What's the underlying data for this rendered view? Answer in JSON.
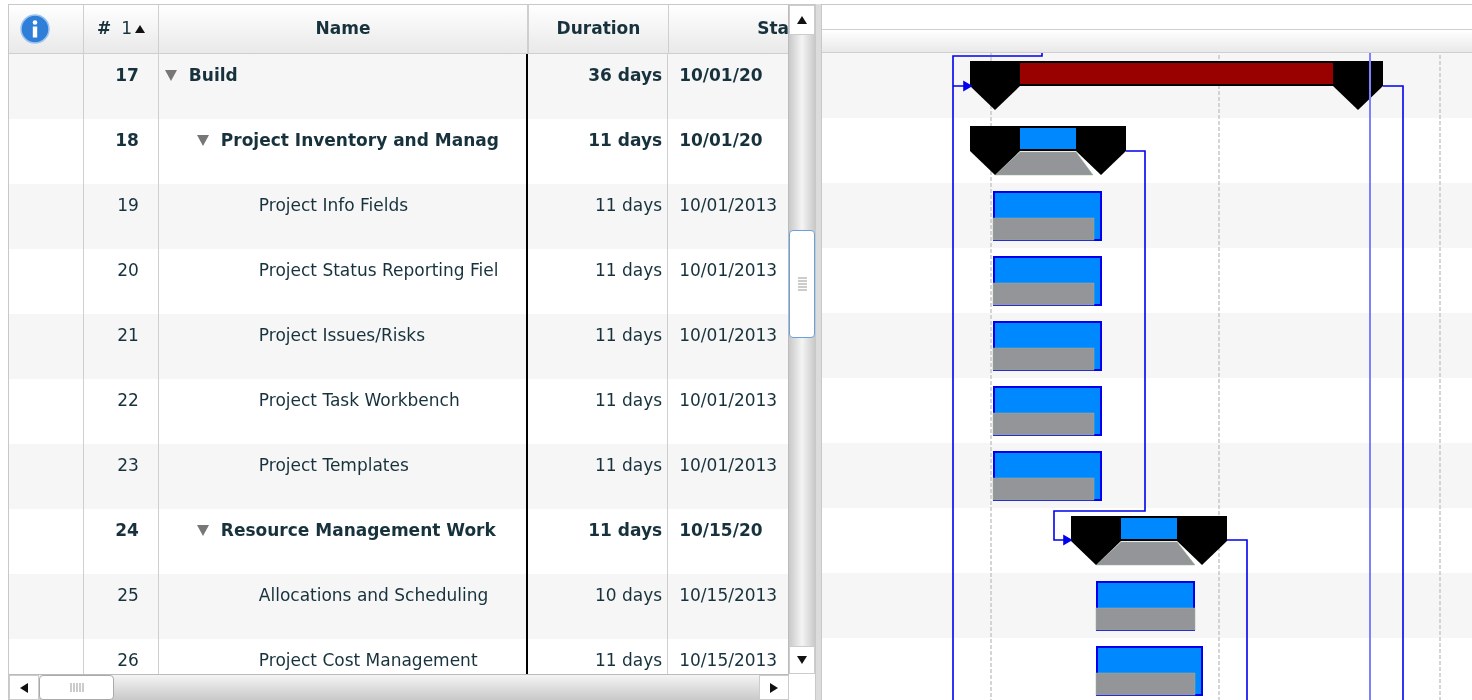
{
  "grid": {
    "columns": [
      {
        "kind": "info"
      },
      {
        "kind": "id",
        "label": "#",
        "sort_index": "1",
        "sort_ascending": true
      },
      {
        "kind": "name",
        "label": "Name"
      },
      {
        "kind": "duration",
        "label": "Duration"
      },
      {
        "kind": "start",
        "label": "Sta"
      }
    ],
    "tasks": [
      {
        "id": "17",
        "name": "Build",
        "duration": "36 days",
        "start": "10/01/20",
        "kind": "summary",
        "expanded": true,
        "children": [
          {
            "id": "18",
            "name": "Project Inventory and Manag",
            "duration": "11 days",
            "start": "10/01/20",
            "kind": "summary",
            "expanded": true,
            "children": [
              {
                "id": "19",
                "name": "Project Info Fields",
                "duration": "11 days",
                "start": "10/01/2013",
                "kind": "task"
              },
              {
                "id": "20",
                "name": "Project Status Reporting Fiel",
                "duration": "11 days",
                "start": "10/01/2013",
                "kind": "task"
              },
              {
                "id": "21",
                "name": "Project Issues/Risks",
                "duration": "11 days",
                "start": "10/01/2013",
                "kind": "task"
              },
              {
                "id": "22",
                "name": "Project Task Workbench",
                "duration": "11 days",
                "start": "10/01/2013",
                "kind": "task"
              },
              {
                "id": "23",
                "name": "Project Templates",
                "duration": "11 days",
                "start": "10/01/2013",
                "kind": "task"
              }
            ]
          },
          {
            "id": "24",
            "name": "Resource Management Work",
            "duration": "11 days",
            "start": "10/15/20",
            "kind": "summary",
            "expanded": true,
            "children": [
              {
                "id": "25",
                "name": "Allocations and Scheduling",
                "duration": "10 days",
                "start": "10/15/2013",
                "kind": "task"
              },
              {
                "id": "26",
                "name": "Project Cost Management",
                "duration": "11 days",
                "start": "10/15/2013",
                "kind": "task"
              }
            ]
          }
        ]
      }
    ]
  }
}
